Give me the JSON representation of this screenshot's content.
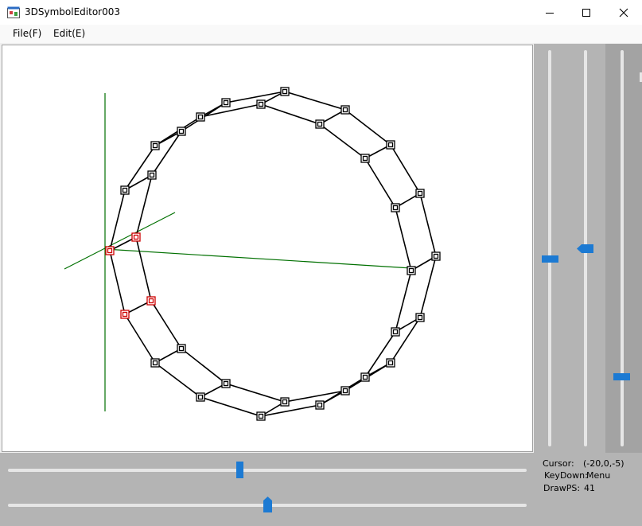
{
  "window": {
    "title": "3DSymbolEditor003"
  },
  "menu": {
    "file": "File(F)",
    "edit": "Edit(E)"
  },
  "status": {
    "cursor_label": "Cursor:",
    "cursor_value": "(-20,0,-5)",
    "keydown_label": "KeyDown:",
    "keydown_value": "Menu",
    "drawps_label": "DrawPS:",
    "drawps_value": "41"
  },
  "colors": {
    "accent": "#1c7ad3",
    "axis": "#007000",
    "selected": "#d00000",
    "panel": "#b4b4b4"
  },
  "icons": [
    "app-icon",
    "minimize-icon",
    "maximize-icon",
    "close-icon"
  ]
}
